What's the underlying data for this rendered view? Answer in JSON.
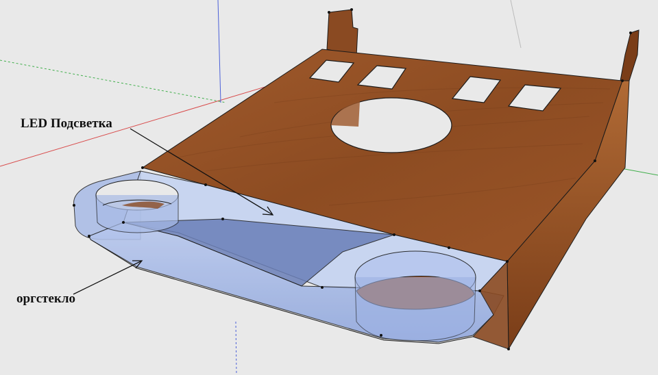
{
  "labels": {
    "led": "LED Подсветка",
    "acrylic": "оргстекло"
  },
  "colors": {
    "background": "#e9e9e9",
    "wood": "#8a4a22",
    "wood_light": "#a65f30",
    "wood_dark": "#6b3616",
    "glass": "#9fb4e0",
    "glass_dark": "#6f86c0",
    "edge": "#1a1a1a",
    "axis_red": "#d84a4a",
    "axis_green": "#3fae4a",
    "axis_blue": "#4a5fd8"
  }
}
